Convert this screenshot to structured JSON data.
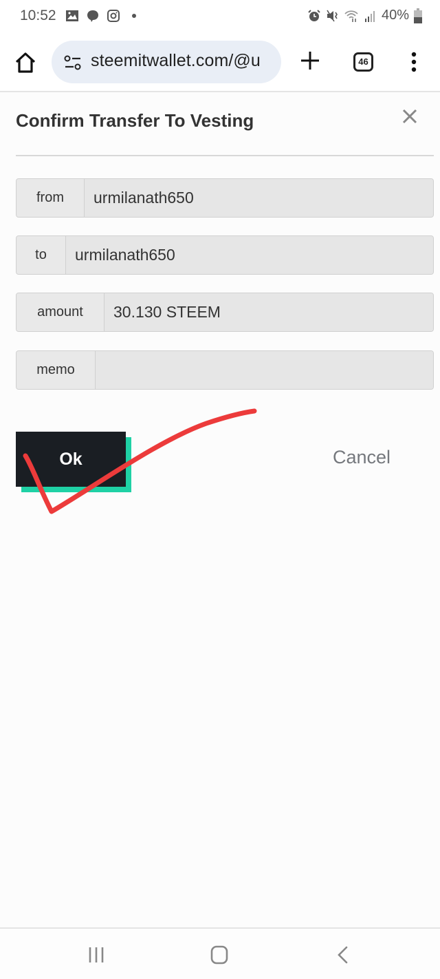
{
  "status_bar": {
    "time": "10:52",
    "left_icons": [
      "gallery-icon",
      "chat-bubble-icon",
      "instagram-icon",
      "dot-icon"
    ],
    "right_icons": [
      "alarm-icon",
      "mute-vibrate-icon",
      "wifi-icon",
      "signal-icon",
      "battery-icon"
    ],
    "battery": "40%"
  },
  "browser": {
    "url": "steemitwallet.com/@u",
    "tab_count": "46"
  },
  "modal": {
    "title": "Confirm Transfer To Vesting",
    "fields": [
      {
        "label": "from",
        "value": "urmilanath650"
      },
      {
        "label": "to",
        "value": "urmilanath650"
      },
      {
        "label": "amount",
        "value": "30.130 STEEM"
      },
      {
        "label": "memo",
        "value": ""
      }
    ],
    "ok_label": "Ok",
    "cancel_label": "Cancel",
    "colors": {
      "ok_bg": "#1a1e23",
      "ok_shadow": "#1fd1a5",
      "annotation": "#ec3b3b"
    }
  }
}
